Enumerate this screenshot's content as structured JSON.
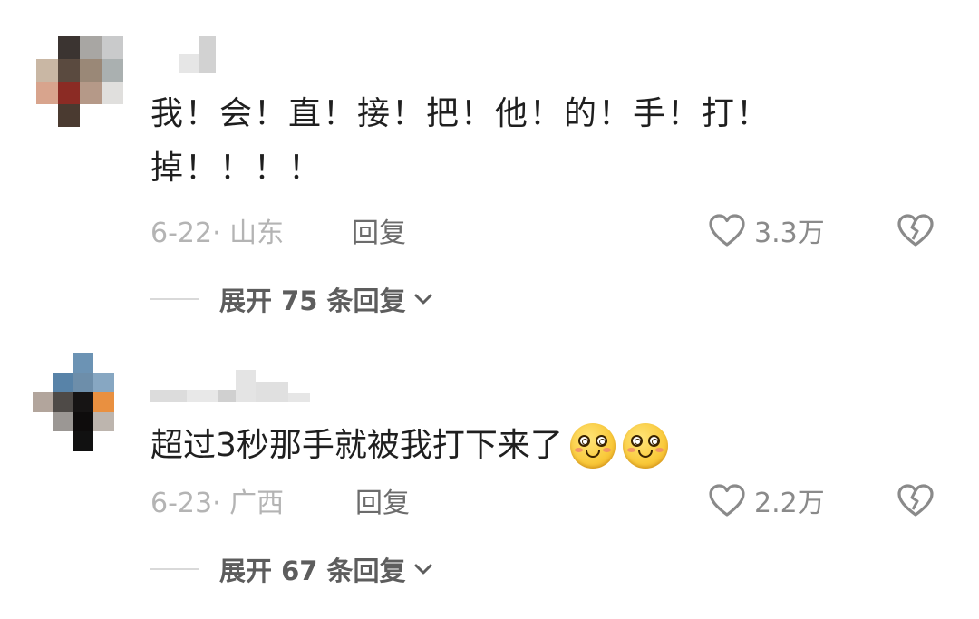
{
  "comments": [
    {
      "text": "我！会！直！接！把！他！的！手！打！掉！！！！",
      "date_location": "6-22· 山东",
      "reply_label": "回复",
      "like_count": "3.3万",
      "expand_label": "展开 75 条回复",
      "avatar_pixels": [
        "#ffffff",
        "#3b3431",
        "#a8a6a3",
        "#c9cacb",
        "#c9b7a4",
        "#5a4a3f",
        "#9a8877",
        "#aab0b0",
        "#d8a48d",
        "#8b2b24",
        "#b59988",
        "#e0dfdd",
        "#ffffff",
        "#4a3a30",
        "#ffffff",
        "#ffffff"
      ]
    },
    {
      "text": "超过3秒那手就被我打下来了",
      "date_location": "6-23· 广西",
      "reply_label": "回复",
      "like_count": "2.2万",
      "expand_label": "展开 67 条回复",
      "avatar_pixels": [
        "#ffffff",
        "#ffffff",
        "#6c93b4",
        "#ffffff",
        "#ffffff",
        "#ffffff",
        "#5883a8",
        "#6d8eaa",
        "#87a7c2",
        "#ffffff",
        "#b2a59c",
        "#4e4a47",
        "#161414",
        "#e99040",
        "#ffffff",
        "#ffffff",
        "#9b9794",
        "#0e0c0c",
        "#bdb5ae",
        "#ffffff",
        "#ffffff",
        "#ffffff",
        "#111111",
        "#ffffff",
        "#ffffff"
      ]
    }
  ],
  "colors": {
    "meta_gray": "#b4b4b4",
    "reply_gray": "#6c6c6c",
    "icon_gray": "#8a8a8a",
    "expand_text": "#5d5d5d"
  }
}
